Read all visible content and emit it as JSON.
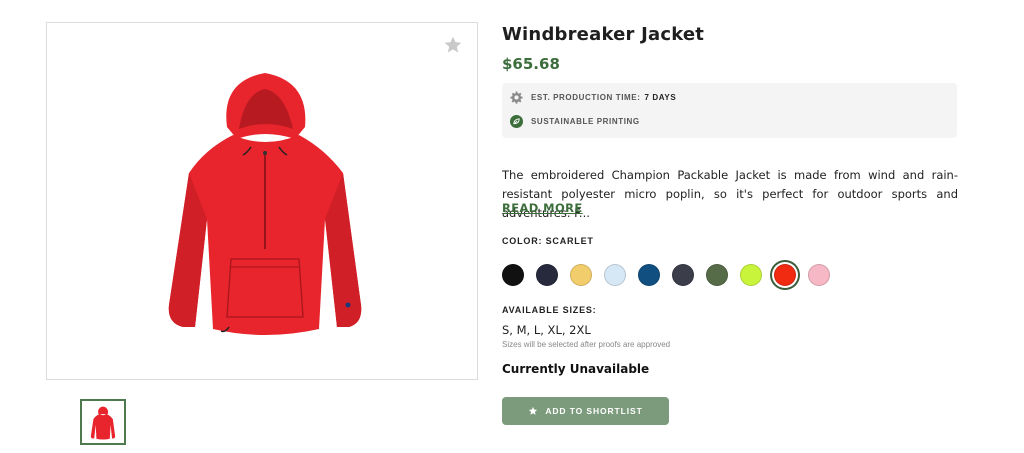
{
  "product": {
    "title": "Windbreaker Jacket",
    "price": "$65.68",
    "production_time_label": "EST. PRODUCTION TIME:",
    "production_time_value": "7 DAYS",
    "sustainable_label": "SUSTAINABLE PRINTING",
    "description": "The embroidered Champion Packable Jacket is made from wind and rain-resistant polyester micro poplin, so it's perfect for outdoor sports and adventures. F...",
    "read_more": "READ MORE",
    "color_label": "COLOR: SCARLET",
    "colors": [
      {
        "name": "black",
        "hex": "#111111"
      },
      {
        "name": "navy",
        "hex": "#262a3c"
      },
      {
        "name": "gold",
        "hex": "#f2cd6b"
      },
      {
        "name": "light-blue",
        "hex": "#d6e7f5"
      },
      {
        "name": "royal",
        "hex": "#104f80"
      },
      {
        "name": "charcoal",
        "hex": "#3b3d4a"
      },
      {
        "name": "olive",
        "hex": "#566b48"
      },
      {
        "name": "lime",
        "hex": "#c9f43c"
      },
      {
        "name": "scarlet",
        "hex": "#f02b12",
        "selected": true
      },
      {
        "name": "pink",
        "hex": "#f5b8c4"
      }
    ],
    "sizes_label": "AVAILABLE SIZES:",
    "sizes_value": "S, M, L, XL, 2XL",
    "sizes_note": "Sizes will be selected after proofs are approved",
    "availability": "Currently Unavailable",
    "shortlist_button": "ADD TO SHORTLIST"
  },
  "theme": {
    "accent": "#3c6e3c",
    "button_bg": "#7c9b7c",
    "jacket_color": "#e8242c"
  },
  "icons": {
    "favorite": "star-icon",
    "production": "gear-icon",
    "sustainable": "leaf-icon",
    "shortlist": "star-icon"
  }
}
